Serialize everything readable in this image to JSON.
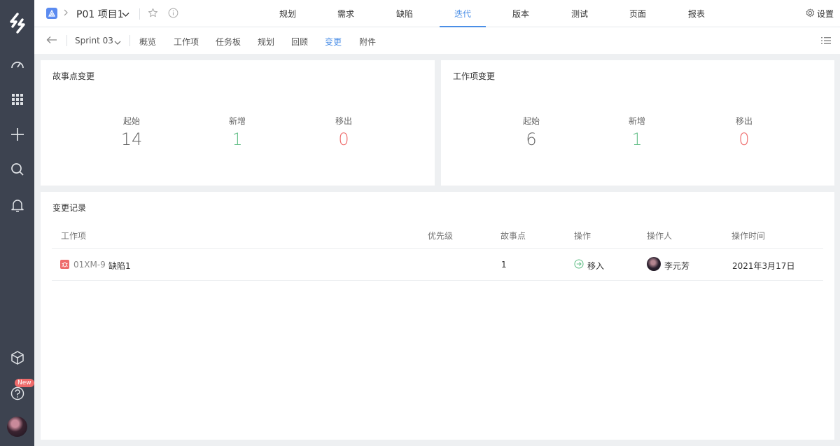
{
  "colors": {
    "accent": "#4a8ee6",
    "positive": "#66c08a",
    "negative": "#ee6a6a",
    "rail": "#3d4350"
  },
  "rail": {
    "icons": [
      "logo-icon",
      "dashboard-icon",
      "apps-grid-icon",
      "add-icon",
      "search-icon",
      "bell-icon",
      "cube-icon",
      "help-icon"
    ],
    "new_badge": "New"
  },
  "header": {
    "project": "P01 项目1",
    "nav": [
      "规划",
      "需求",
      "缺陷",
      "迭代",
      "版本",
      "测试",
      "页面",
      "报表"
    ],
    "active_nav": "迭代",
    "settings_label": "设置"
  },
  "subnav": {
    "sprint": "Sprint 03",
    "tabs": [
      "概览",
      "工作项",
      "任务板",
      "规划",
      "回顾",
      "变更",
      "附件"
    ],
    "active_tab": "变更"
  },
  "story_points": {
    "title": "故事点变更",
    "stats": [
      {
        "label": "起始",
        "value": "14"
      },
      {
        "label": "新增",
        "value": "1"
      },
      {
        "label": "移出",
        "value": "0"
      }
    ]
  },
  "work_items": {
    "title": "工作项变更",
    "stats": [
      {
        "label": "起始",
        "value": "6"
      },
      {
        "label": "新增",
        "value": "1"
      },
      {
        "label": "移出",
        "value": "0"
      }
    ]
  },
  "change_log": {
    "title": "变更记录",
    "columns": [
      "工作项",
      "优先级",
      "故事点",
      "操作",
      "操作人",
      "操作时间"
    ],
    "rows": [
      {
        "id": "01XM-9",
        "name": "缺陷1",
        "priority": "",
        "points": "1",
        "action": "移入",
        "operator": "李元芳",
        "time": "2021年3月17日"
      }
    ]
  }
}
